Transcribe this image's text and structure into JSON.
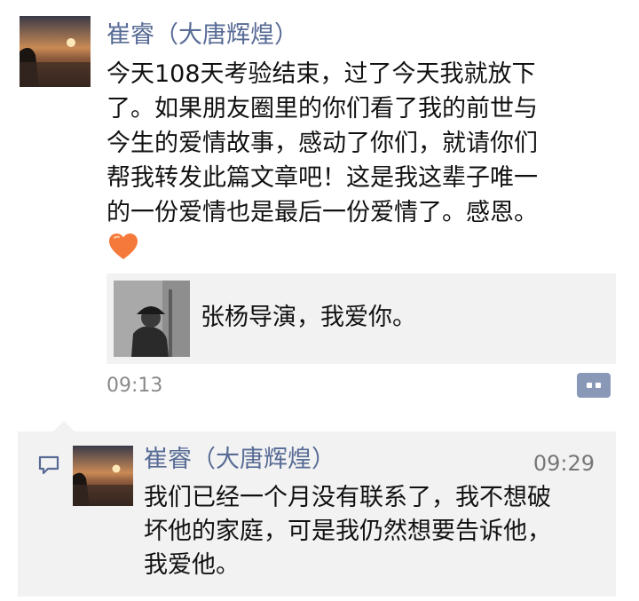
{
  "post": {
    "author": "崔睿（大唐辉煌）",
    "text_lines": [
      "今天108天考验结束，过了今天我就放下",
      "了。如果朋友圈里的你们看了我的前世与",
      "今生的爱情故事，感动了你们，就请你们",
      "帮我转发此篇文章吧！这是我这辈子唯一",
      "的一份爱情也是最后一份爱情了。感恩。"
    ],
    "emoji": "orange-heart",
    "shared_link": {
      "title": "张杨导演，我爱你。",
      "thumbnail": "man-in-cap-photo"
    },
    "time": "09:13",
    "more_icon": "two-dots-icon"
  },
  "comment": {
    "author": "崔睿（大唐辉煌）",
    "time": "09:29",
    "text_lines": [
      "我们已经一个月没有联系了，我不想破",
      "坏他的家庭，可是我仍然想要告诉他，",
      "我爱他。"
    ],
    "icon": "comment-bubble-icon"
  },
  "colors": {
    "name_link": "#576b95",
    "time_gray": "#8a8a8a",
    "panel_bg": "#f2f2f2",
    "heart": "#f5793a"
  }
}
